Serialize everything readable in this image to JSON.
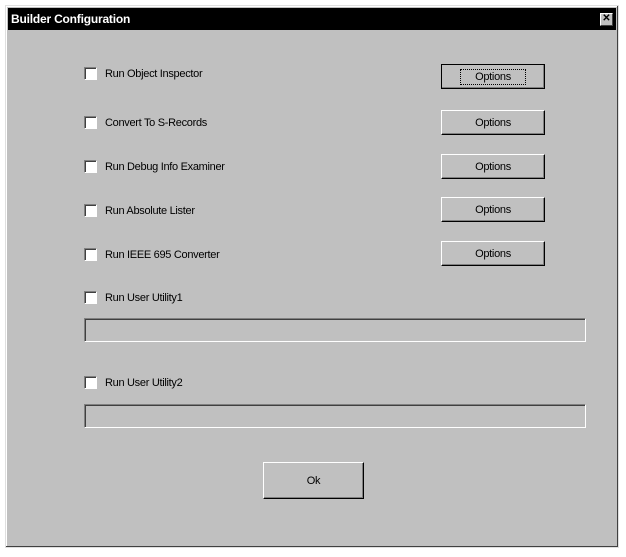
{
  "window": {
    "title": "Builder Configuration",
    "close_glyph": "✕"
  },
  "options": [
    {
      "label": "Run Object Inspector",
      "checked": false,
      "button": "Options"
    },
    {
      "label": "Convert To S-Records",
      "checked": false,
      "button": "Options"
    },
    {
      "label": "Run Debug Info Examiner",
      "checked": false,
      "button": "Options"
    },
    {
      "label": "Run Absolute Lister",
      "checked": false,
      "button": "Options"
    },
    {
      "label": "Run IEEE 695 Converter",
      "checked": false,
      "button": "Options"
    }
  ],
  "user_utilities": [
    {
      "label": "Run User Utility1",
      "checked": false,
      "value": ""
    },
    {
      "label": "Run User Utility2",
      "checked": false,
      "value": ""
    }
  ],
  "ok_label": "Ok"
}
